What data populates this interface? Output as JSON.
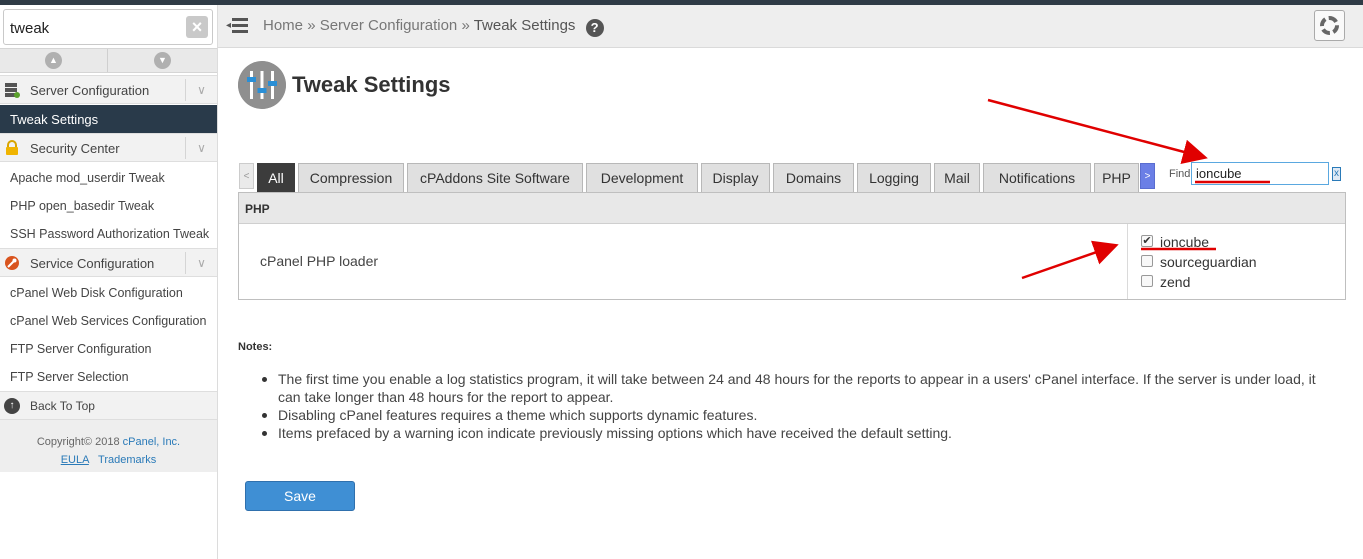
{
  "search": {
    "value": "tweak"
  },
  "sidebar": {
    "categories": [
      {
        "label": "Server Configuration"
      },
      {
        "label": "Security Center"
      },
      {
        "label": "Service Configuration"
      }
    ],
    "active_item": "Tweak Settings",
    "security_items": [
      "Apache mod_userdir Tweak",
      "PHP open_basedir Tweak",
      "SSH Password Authorization Tweak"
    ],
    "service_items": [
      "cPanel Web Disk Configuration",
      "cPanel Web Services Configuration",
      "FTP Server Configuration",
      "FTP Server Selection"
    ],
    "back_to_top": "Back To Top",
    "footer": {
      "copyright": "Copyright© 2018",
      "company": "cPanel, Inc.",
      "eula": "EULA",
      "trademarks": "Trademarks"
    }
  },
  "header": {
    "breadcrumb": [
      "Home",
      "Server Configuration",
      "Tweak Settings"
    ],
    "separator": "»",
    "help": "?"
  },
  "main": {
    "title": "Tweak Settings",
    "tabs": [
      "All",
      "Compression",
      "cPAddons Site Software",
      "Development",
      "Display",
      "Domains",
      "Logging",
      "Mail",
      "Notifications",
      "PHP"
    ],
    "find_label": "Find",
    "find_value": "ioncube",
    "find_clear": "x",
    "section": "PHP",
    "setting_label": "cPanel PHP loader",
    "options": [
      {
        "label": "ioncube",
        "checked": true
      },
      {
        "label": "sourceguardian",
        "checked": false
      },
      {
        "label": "zend",
        "checked": false
      }
    ],
    "notes_title": "Notes:",
    "notes": [
      "The first time you enable a log statistics program, it will take between 24 and 48 hours for the reports to appear in a users' cPanel interface. If the server is under load, it can take longer than 48 hours for the report to appear.",
      "Disabling cPanel features requires a theme which supports dynamic features.",
      "Items prefaced by a warning icon indicate previously missing options which have received the default setting."
    ],
    "save_label": "Save"
  },
  "colors": {
    "active_nav": "#293a4a",
    "save_button": "#3f8fd4",
    "annotation": "#e00000"
  }
}
